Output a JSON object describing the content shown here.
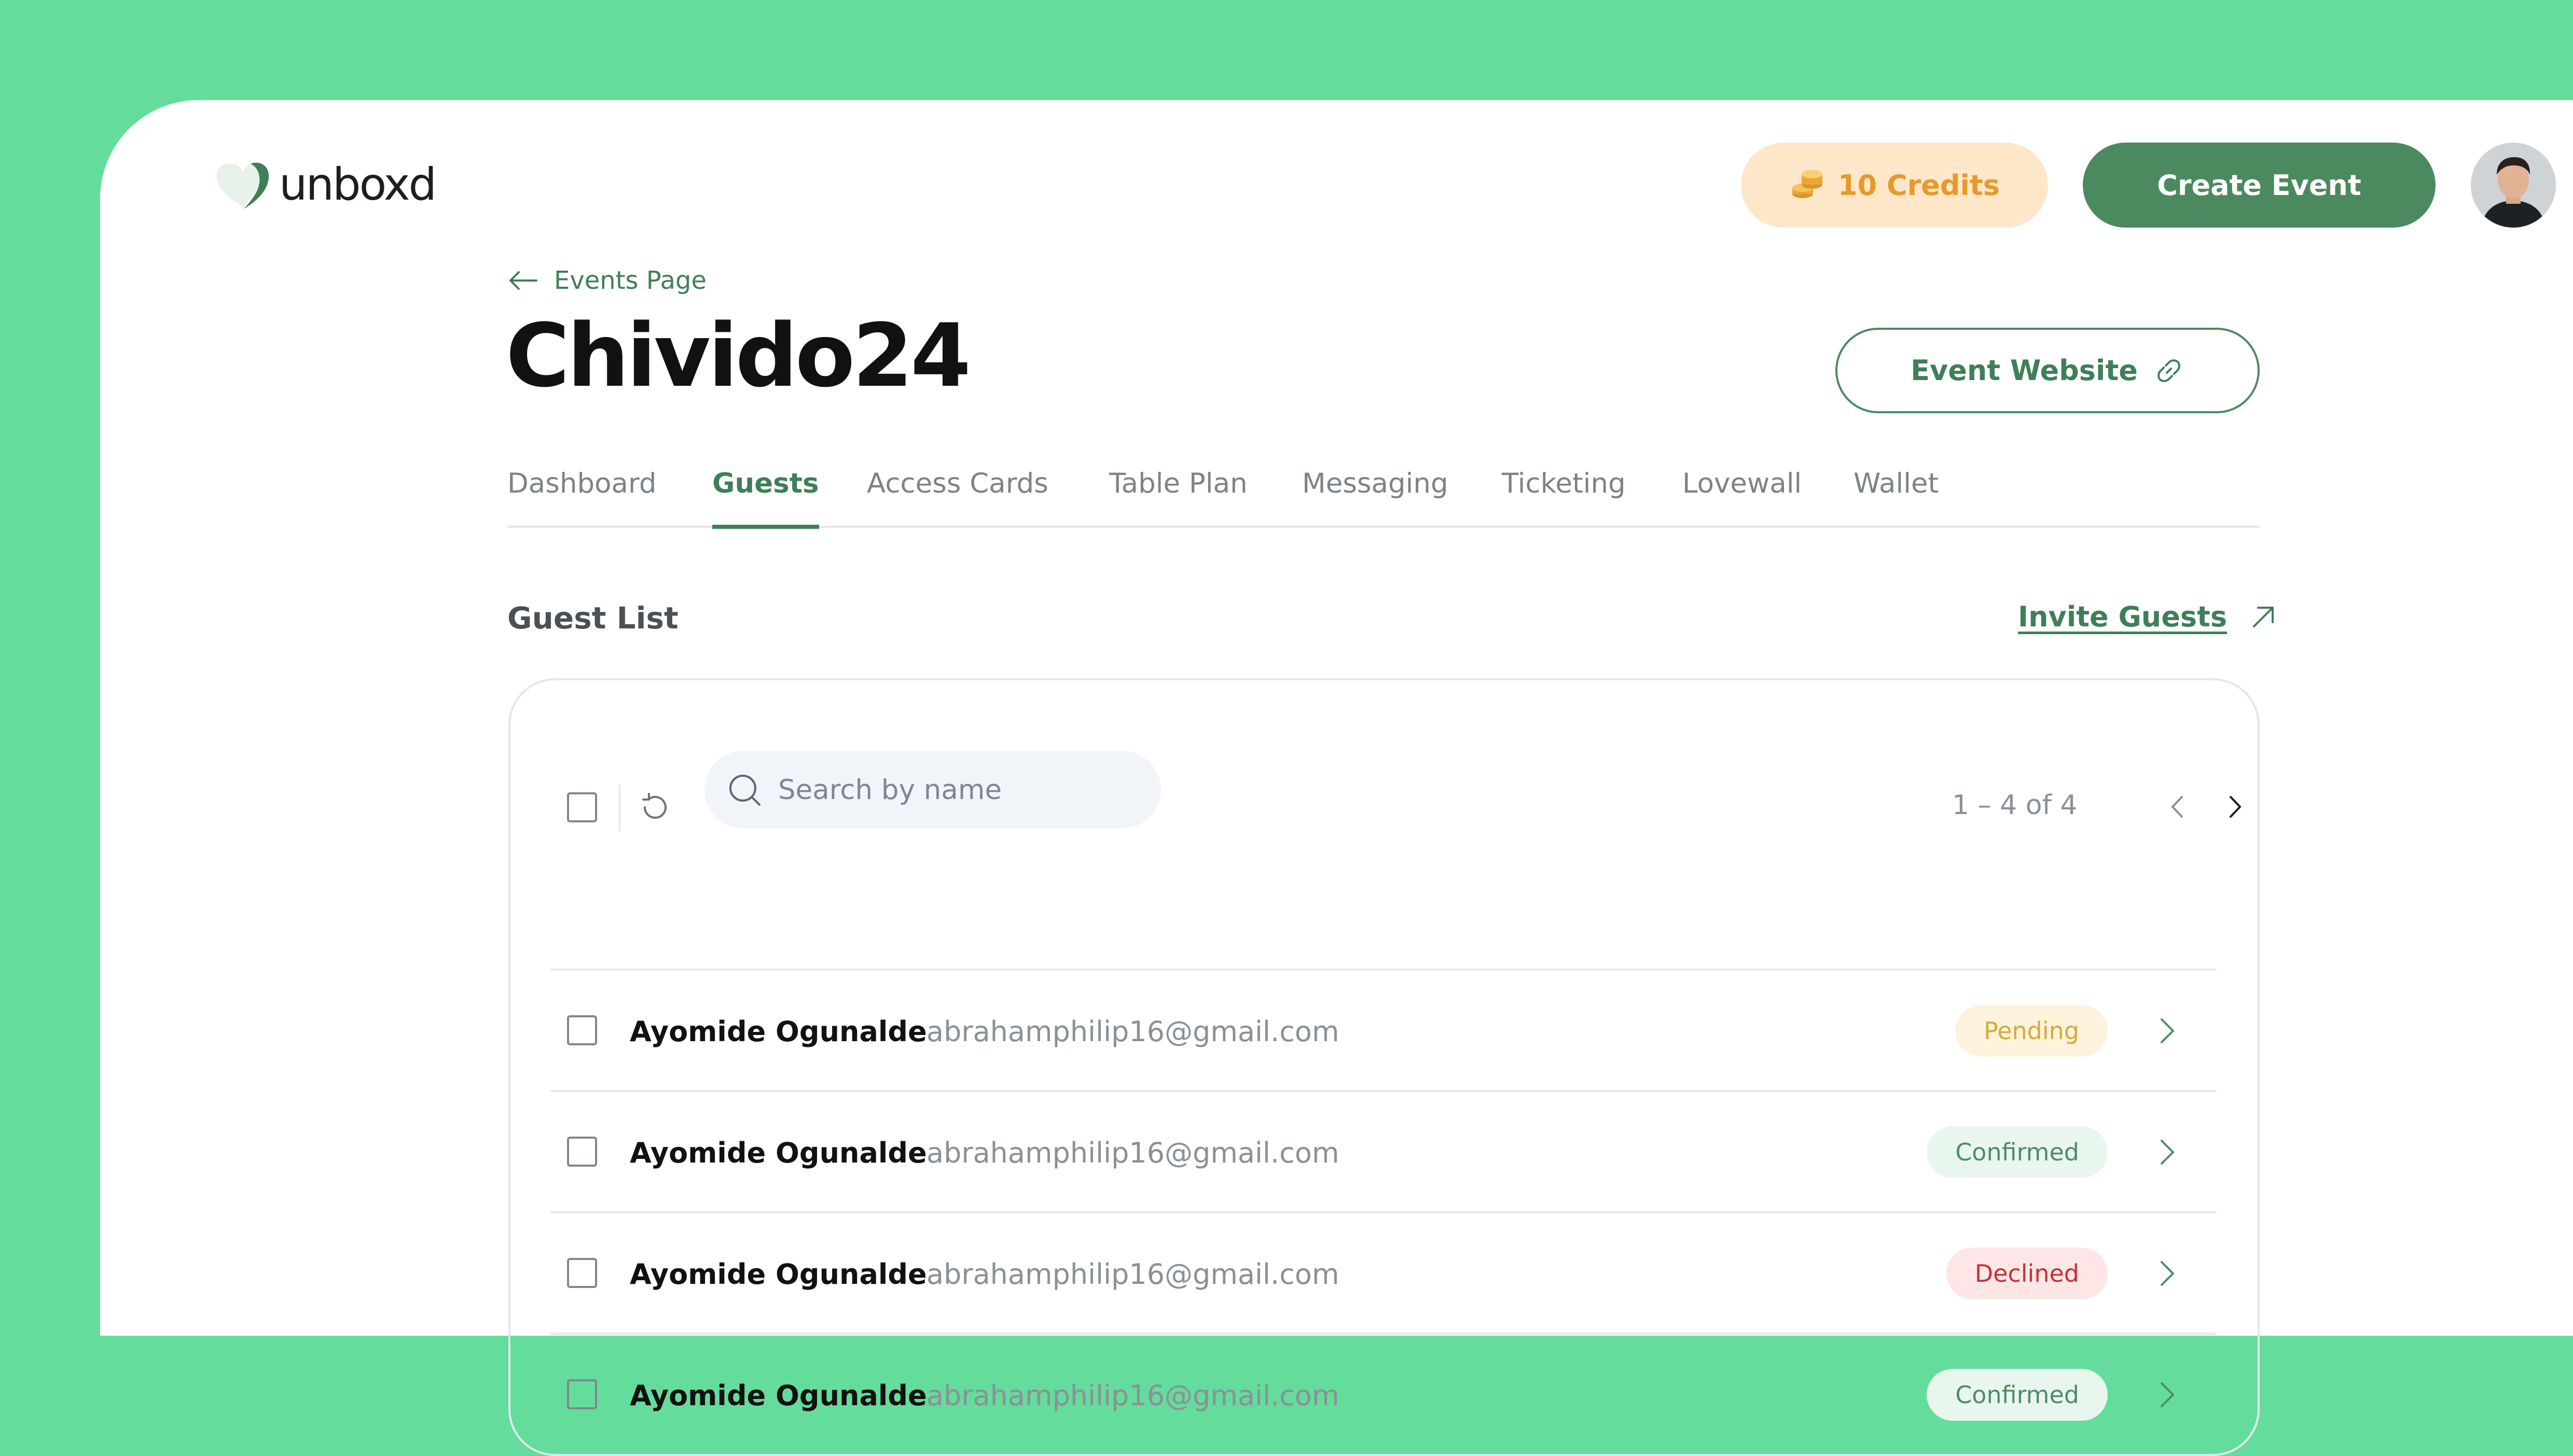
{
  "brand": {
    "name": "unboxd"
  },
  "header": {
    "credits_label": "10 Credits",
    "create_event_label": "Create Event",
    "avatar_alt": "user avatar"
  },
  "page": {
    "back_label": "Events Page",
    "title": "Chivido24",
    "website_label": "Event Website"
  },
  "tabs": [
    {
      "label": "Dashboard",
      "active": false
    },
    {
      "label": "Guests",
      "active": true
    },
    {
      "label": "Access Cards",
      "active": false
    },
    {
      "label": "Table Plan",
      "active": false
    },
    {
      "label": "Messaging",
      "active": false
    },
    {
      "label": "Ticketing",
      "active": false
    },
    {
      "label": "Lovewall",
      "active": false
    },
    {
      "label": "Wallet",
      "active": false
    }
  ],
  "guest_list": {
    "title": "Guest List",
    "invite_label": "Invite Guests",
    "search_placeholder": "Search by name",
    "pagination": "1 – 4 of 4",
    "rows": [
      {
        "name": "Ayomide Ogunalde",
        "email": "abrahamphilip16@gmail.com",
        "status": "Pending"
      },
      {
        "name": "Ayomide Ogunalde",
        "email": "abrahamphilip16@gmail.com",
        "status": "Confirmed"
      },
      {
        "name": "Ayomide Ogunalde",
        "email": "abrahamphilip16@gmail.com",
        "status": "Declined"
      },
      {
        "name": "Ayomide Ogunalde",
        "email": "abrahamphilip16@gmail.com",
        "status": "Confirmed"
      }
    ]
  },
  "colors": {
    "brand_green": "#4b8a5e",
    "background_green": "#64dc9c",
    "credits_bg": "#fde7c8",
    "credits_text": "#e59a2c"
  },
  "icons": [
    "logo-heart-icon",
    "coins-icon",
    "arrow-left-icon",
    "link-icon",
    "arrow-up-right-icon",
    "refresh-icon",
    "search-icon",
    "chevron-left-icon",
    "chevron-right-icon"
  ]
}
